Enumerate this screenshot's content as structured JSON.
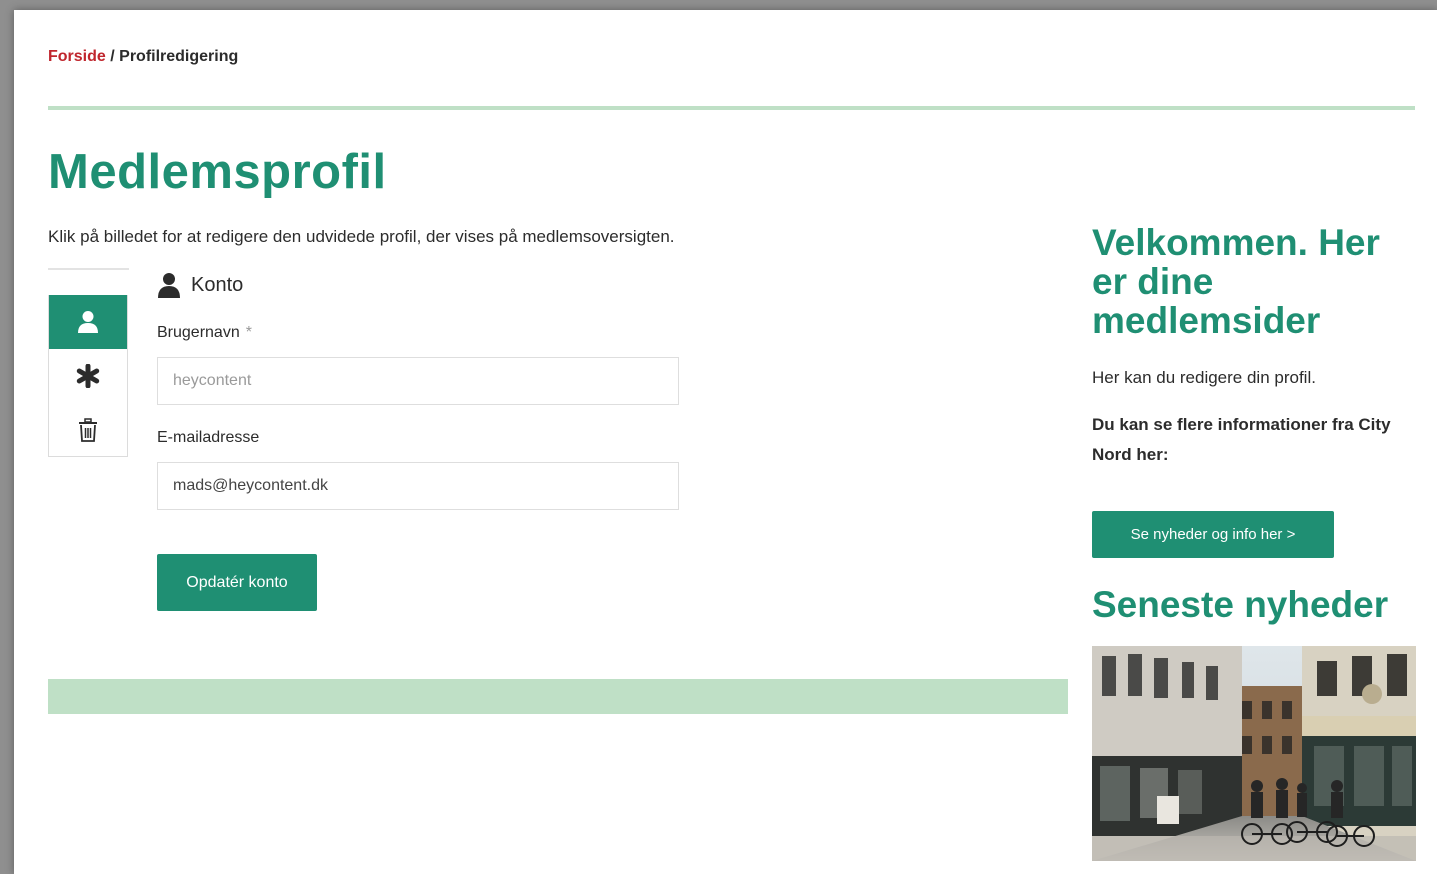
{
  "breadcrumb": {
    "home": "Forside",
    "separator": " / ",
    "current": "Profilredigering"
  },
  "page_title": "Medlemsprofil",
  "intro": "Klik på billedet for at redigere den udvidede profil, der vises på medlemsoversigten.",
  "tabs": [
    {
      "icon": "user-icon",
      "active": true
    },
    {
      "icon": "asterisk-icon",
      "active": false
    },
    {
      "icon": "trash-icon",
      "active": false
    }
  ],
  "account": {
    "title": "Konto",
    "username_label": "Brugernavn",
    "required_mark": "*",
    "username_value": "heycontent",
    "email_label": "E-mailadresse",
    "email_value": "mads@heycontent.dk",
    "submit_label": "Opdatér konto"
  },
  "sidebar": {
    "welcome_title": "Velkommen. Her er dine medlemsider",
    "welcome_text": "Her kan du redigere din profil.",
    "info_text": "Du kan se flere informationer fra City Nord her:",
    "news_button": "Se nyheder og info her >",
    "latest_news_title": "Seneste nyheder"
  },
  "colors": {
    "accent": "#1f8f73",
    "divider": "#bfe0c6",
    "link_red": "#c0262d"
  }
}
